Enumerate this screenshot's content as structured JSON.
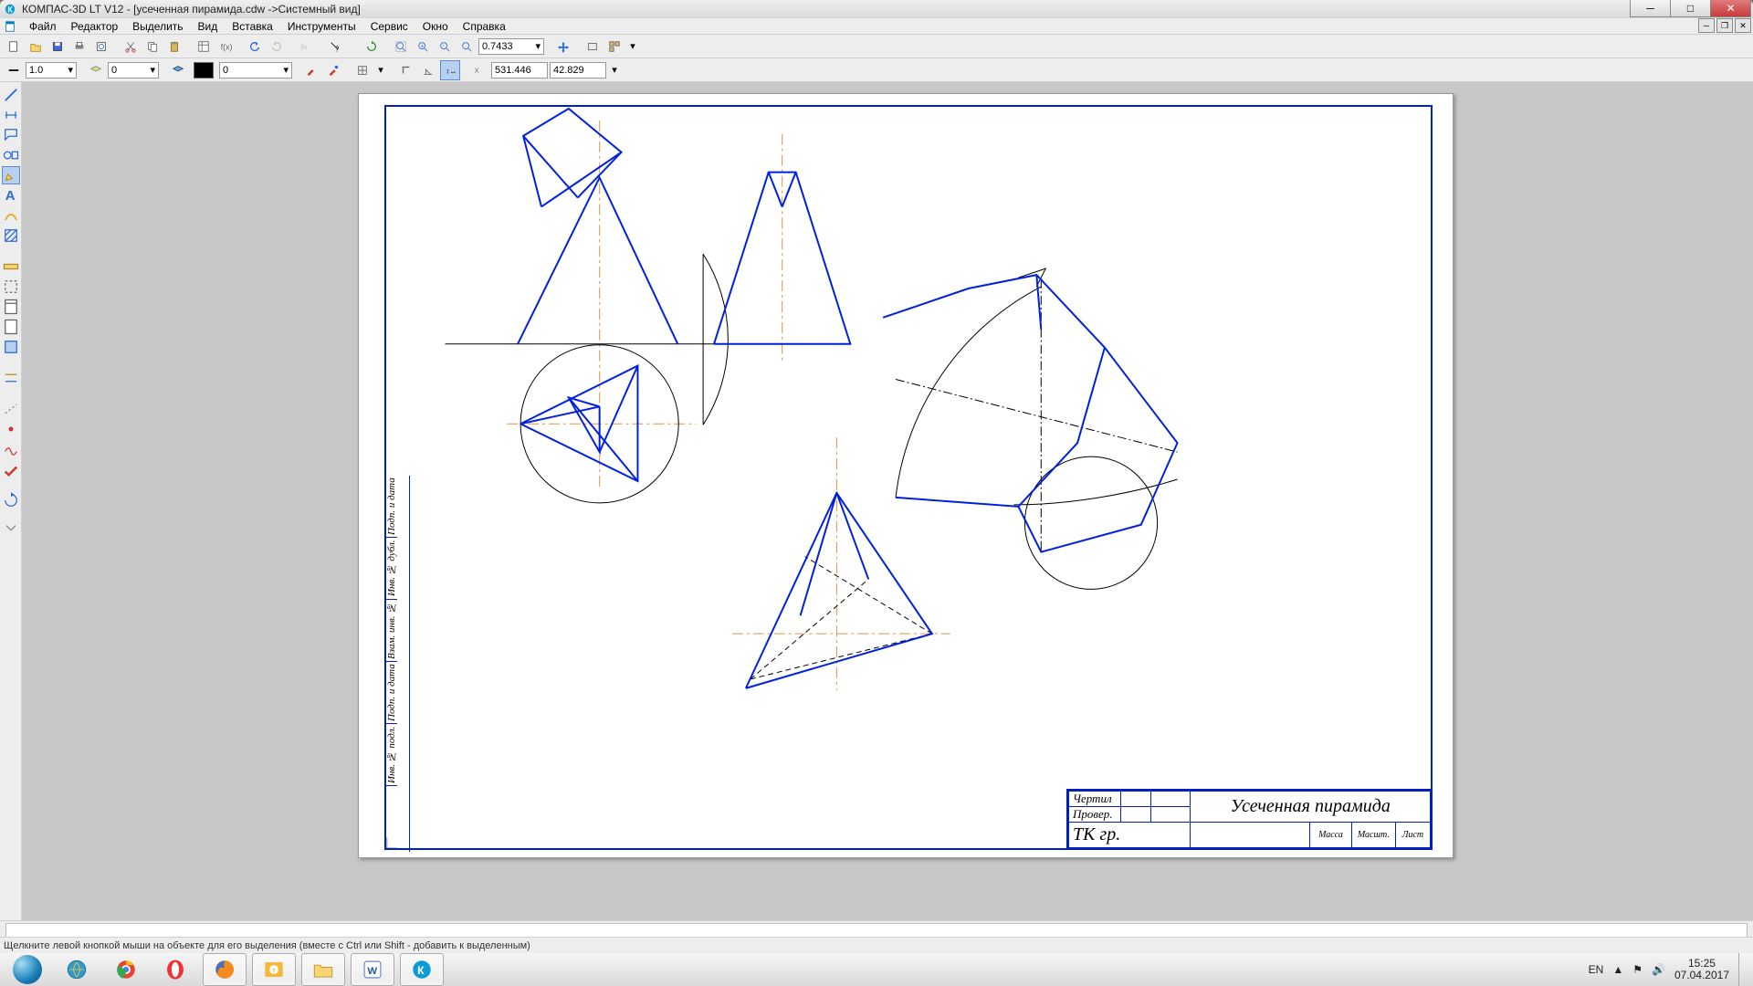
{
  "window": {
    "app": "КОМПАС-3D LT V12",
    "doc": "[усеченная пирамида.cdw ->Системный вид]"
  },
  "menu": {
    "file": "Файл",
    "edit": "Редактор",
    "select": "Выделить",
    "view": "Вид",
    "insert": "Вставка",
    "tools": "Инструменты",
    "service": "Сервис",
    "window": "Окно",
    "help": "Справка"
  },
  "toolbar": {
    "zoom": "0.7433",
    "linewidth": "1.0",
    "layer": "0",
    "style": "0",
    "coord_x": "531.446",
    "coord_y": "42.829"
  },
  "drawing": {
    "title": "Усеченная пирамида",
    "stamp": {
      "r1": "Чертил",
      "r2": "Провер.",
      "group": "ТК гр.",
      "mass": "Масса",
      "scale": "Масшт.",
      "sheet": "Лист"
    }
  },
  "status": {
    "hint": "Щелкните левой кнопкой мыши на объекте для его выделения (вместе с Ctrl или Shift - добавить к выделенным)"
  },
  "tray": {
    "lang": "EN",
    "time": "15:25",
    "date": "07.04.2017"
  }
}
